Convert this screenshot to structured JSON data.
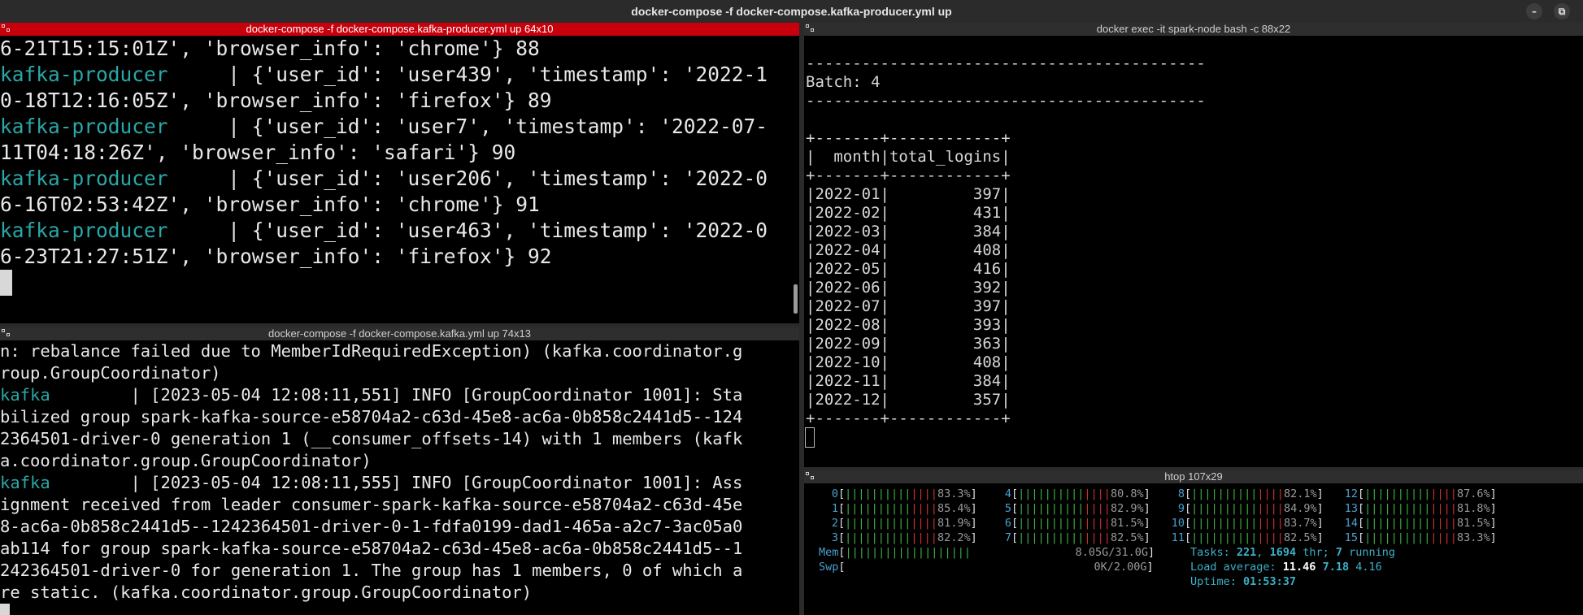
{
  "window": {
    "title": "docker-compose -f docker-compose.kafka-producer.yml up",
    "minimize_glyph": "–",
    "restore_glyph": "⧉"
  },
  "panes": {
    "producer": {
      "title": "docker-compose -f docker-compose.kafka-producer.yml up 64x10",
      "lines": [
        [
          {
            "t": "6-21T15:15:01Z', 'browser_info': 'chrome'} 88"
          }
        ],
        [
          {
            "t": "kafka-producer",
            "c": "teal"
          },
          {
            "t": "     | {'user_id': 'user439', 'timestamp': '2022-1"
          }
        ],
        [
          {
            "t": "0-18T12:16:05Z', 'browser_info': 'firefox'} 89"
          }
        ],
        [
          {
            "t": "kafka-producer",
            "c": "teal"
          },
          {
            "t": "     | {'user_id': 'user7', 'timestamp': '2022-07-"
          }
        ],
        [
          {
            "t": "11T04:18:26Z', 'browser_info': 'safari'} 90"
          }
        ],
        [
          {
            "t": "kafka-producer",
            "c": "teal"
          },
          {
            "t": "     | {'user_id': 'user206', 'timestamp': '2022-0"
          }
        ],
        [
          {
            "t": "6-16T02:53:42Z', 'browser_info': 'chrome'} 91"
          }
        ],
        [
          {
            "t": "kafka-producer",
            "c": "teal"
          },
          {
            "t": "     | {'user_id': 'user463', 'timestamp': '2022-0"
          }
        ],
        [
          {
            "t": "6-23T21:27:51Z', 'browser_info': 'firefox'} 92"
          }
        ]
      ]
    },
    "kafka": {
      "title": "docker-compose -f docker-compose.kafka.yml up 74x13",
      "lines": [
        [
          {
            "t": "n: rebalance failed due to MemberIdRequiredException) (kafka.coordinator.g"
          }
        ],
        [
          {
            "t": "roup.GroupCoordinator)"
          }
        ],
        [
          {
            "t": "kafka",
            "c": "teal"
          },
          {
            "t": "        | [2023-05-04 12:08:11,551] INFO [GroupCoordinator 1001]: Sta"
          }
        ],
        [
          {
            "t": "bilized group spark-kafka-source-e58704a2-c63d-45e8-ac6a-0b858c2441d5--124"
          }
        ],
        [
          {
            "t": "2364501-driver-0 generation 1 (__consumer_offsets-14) with 1 members (kafk"
          }
        ],
        [
          {
            "t": "a.coordinator.group.GroupCoordinator)"
          }
        ],
        [
          {
            "t": "kafka",
            "c": "teal"
          },
          {
            "t": "        | [2023-05-04 12:08:11,555] INFO [GroupCoordinator 1001]: Ass"
          }
        ],
        [
          {
            "t": "ignment received from leader consumer-spark-kafka-source-e58704a2-c63d-45e"
          }
        ],
        [
          {
            "t": "8-ac6a-0b858c2441d5--1242364501-driver-0-1-fdfa0199-dad1-465a-a2c7-3ac05a0"
          }
        ],
        [
          {
            "t": "ab114 for group spark-kafka-source-e58704a2-c63d-45e8-ac6a-0b858c2441d5--1"
          }
        ],
        [
          {
            "t": "242364501-driver-0 for generation 1. The group has 1 members, 0 of which a"
          }
        ],
        [
          {
            "t": "re static. (kafka.coordinator.group.GroupCoordinator)"
          }
        ]
      ]
    },
    "spark": {
      "title": "docker exec -it spark-node bash -c  88x22",
      "lines": [
        [
          {
            "t": ""
          }
        ],
        [
          {
            "t": "-------------------------------------------"
          }
        ],
        [
          {
            "t": "Batch: 4"
          }
        ],
        [
          {
            "t": "-------------------------------------------"
          }
        ],
        [
          {
            "t": ""
          }
        ],
        [
          {
            "t": "+-------+------------+"
          }
        ],
        [
          {
            "t": "|  month|total_logins|"
          }
        ],
        [
          {
            "t": "+-------+------------+"
          }
        ],
        [
          {
            "t": "|2022-01|         397|"
          }
        ],
        [
          {
            "t": "|2022-02|         431|"
          }
        ],
        [
          {
            "t": "|2022-03|         384|"
          }
        ],
        [
          {
            "t": "|2022-04|         408|"
          }
        ],
        [
          {
            "t": "|2022-05|         416|"
          }
        ],
        [
          {
            "t": "|2022-06|         392|"
          }
        ],
        [
          {
            "t": "|2022-07|         397|"
          }
        ],
        [
          {
            "t": "|2022-08|         393|"
          }
        ],
        [
          {
            "t": "|2022-09|         363|"
          }
        ],
        [
          {
            "t": "|2022-10|         408|"
          }
        ],
        [
          {
            "t": "|2022-11|         384|"
          }
        ],
        [
          {
            "t": "|2022-12|         357|"
          }
        ],
        [
          {
            "t": "+-------+------------+"
          }
        ]
      ]
    },
    "htop": {
      "title": "htop 107x29",
      "cpus": [
        {
          "id": "0",
          "pct": "83.3%"
        },
        {
          "id": "1",
          "pct": "85.4%"
        },
        {
          "id": "2",
          "pct": "81.9%"
        },
        {
          "id": "3",
          "pct": "82.2%"
        },
        {
          "id": "4",
          "pct": "80.8%"
        },
        {
          "id": "5",
          "pct": "82.9%"
        },
        {
          "id": "6",
          "pct": "81.5%"
        },
        {
          "id": "7",
          "pct": "82.5%"
        },
        {
          "id": "8",
          "pct": "82.1%"
        },
        {
          "id": "9",
          "pct": "84.9%"
        },
        {
          "id": "10",
          "pct": "83.7%"
        },
        {
          "id": "11",
          "pct": "82.5%"
        },
        {
          "id": "12",
          "pct": "87.6%"
        },
        {
          "id": "13",
          "pct": "81.8%"
        },
        {
          "id": "14",
          "pct": "81.5%"
        },
        {
          "id": "15",
          "pct": "83.3%"
        }
      ],
      "mem_label": "Mem",
      "mem_value": "8.05G/31.0G",
      "swp_label": "Swp",
      "swp_value": "0K/2.00G",
      "tasks_label": "Tasks: ",
      "tasks_count": "221",
      "thr_count": "1694",
      "thr_label": " thr; ",
      "running_count": "7",
      "running_label": " running",
      "load_label": "Load average: ",
      "load_1": "11.46",
      "load_5": "7.18",
      "load_15": "4.16",
      "uptime_label": "Uptime: ",
      "uptime": "01:53:37"
    }
  }
}
